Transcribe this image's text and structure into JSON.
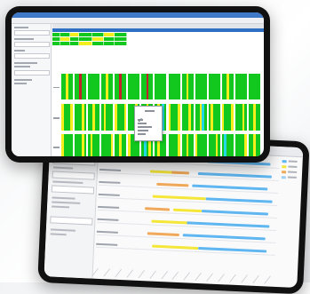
{
  "front_window": {
    "titlebar_color": "#3e78c7",
    "selected_row_color": "#2f6fc4",
    "status_colors": {
      "ok": "#12c81e",
      "warning": "#f4ee1c",
      "alert": "#c0202a",
      "info": "#22d7e6"
    },
    "popup_icon": "pencil-icon"
  },
  "back_window": {
    "legend_colors": [
      "#5fb6f0",
      "#f5e63a",
      "#f0a95a",
      "#9fd0f3"
    ],
    "bar_colors": {
      "primary": "#5fb6f0",
      "secondary": "#f5e63a",
      "tertiary": "#f0a95a"
    }
  }
}
